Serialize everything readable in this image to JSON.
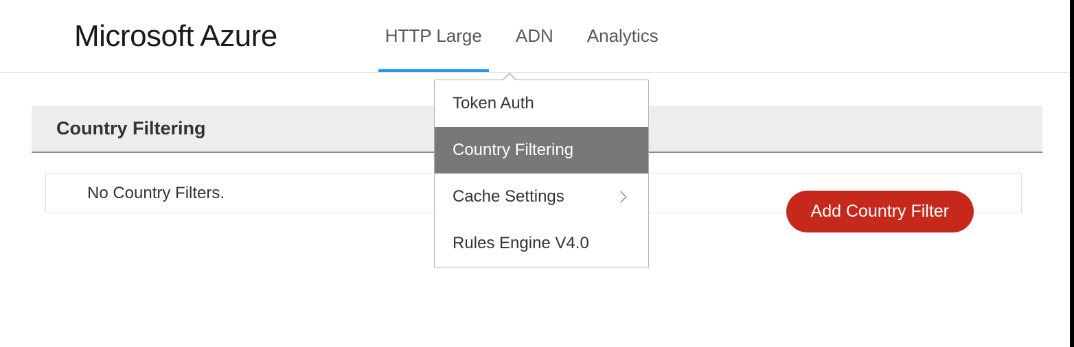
{
  "header": {
    "logo": "Microsoft Azure",
    "tabs": [
      {
        "label": "HTTP Large",
        "active": true
      },
      {
        "label": "ADN",
        "active": false
      },
      {
        "label": "Analytics",
        "active": false
      }
    ]
  },
  "dropdown": {
    "items": [
      {
        "label": "Token Auth",
        "selected": false,
        "hasSubmenu": false
      },
      {
        "label": "Country Filtering",
        "selected": true,
        "hasSubmenu": false
      },
      {
        "label": "Cache Settings",
        "selected": false,
        "hasSubmenu": true
      },
      {
        "label": "Rules Engine V4.0",
        "selected": false,
        "hasSubmenu": false
      }
    ]
  },
  "section": {
    "title": "Country Filtering",
    "emptyMessage": "No Country Filters."
  },
  "actions": {
    "addButton": "Add Country Filter"
  }
}
